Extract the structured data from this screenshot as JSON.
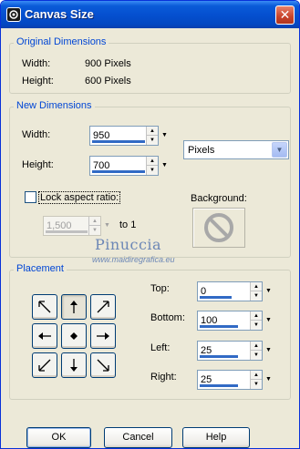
{
  "window": {
    "title": "Canvas Size",
    "close_label": "✕"
  },
  "original": {
    "legend": "Original Dimensions",
    "width_label": "Width:",
    "width_value": "900 Pixels",
    "height_label": "Height:",
    "height_value": "600 Pixels"
  },
  "new_dims": {
    "legend": "New Dimensions",
    "width_label": "Width:",
    "width_value": "950",
    "height_label": "Height:",
    "height_value": "700",
    "units_value": "Pixels",
    "lock_label": "Lock aspect ratio:",
    "lock_checked": false,
    "ratio_value": "1,500",
    "to_label": "to 1",
    "background_label": "Background:"
  },
  "watermark": {
    "line1": "Pinuccia",
    "line2": "www.maidiregrafica.eu"
  },
  "placement": {
    "legend": "Placement",
    "buttons": [
      "top-left",
      "top-center",
      "top-right",
      "middle-left",
      "center",
      "middle-right",
      "bottom-left",
      "bottom-center",
      "bottom-right"
    ],
    "selected": "top-center",
    "top_label": "Top:",
    "top_value": "0",
    "bottom_label": "Bottom:",
    "bottom_value": "100",
    "left_label": "Left:",
    "left_value": "25",
    "right_label": "Right:",
    "right_value": "25"
  },
  "buttons": {
    "ok": "OK",
    "cancel": "Cancel",
    "help": "Help"
  },
  "colors": {
    "accent": "#316ac5",
    "legend": "#0046d5",
    "titlebar": "#0550d0"
  }
}
